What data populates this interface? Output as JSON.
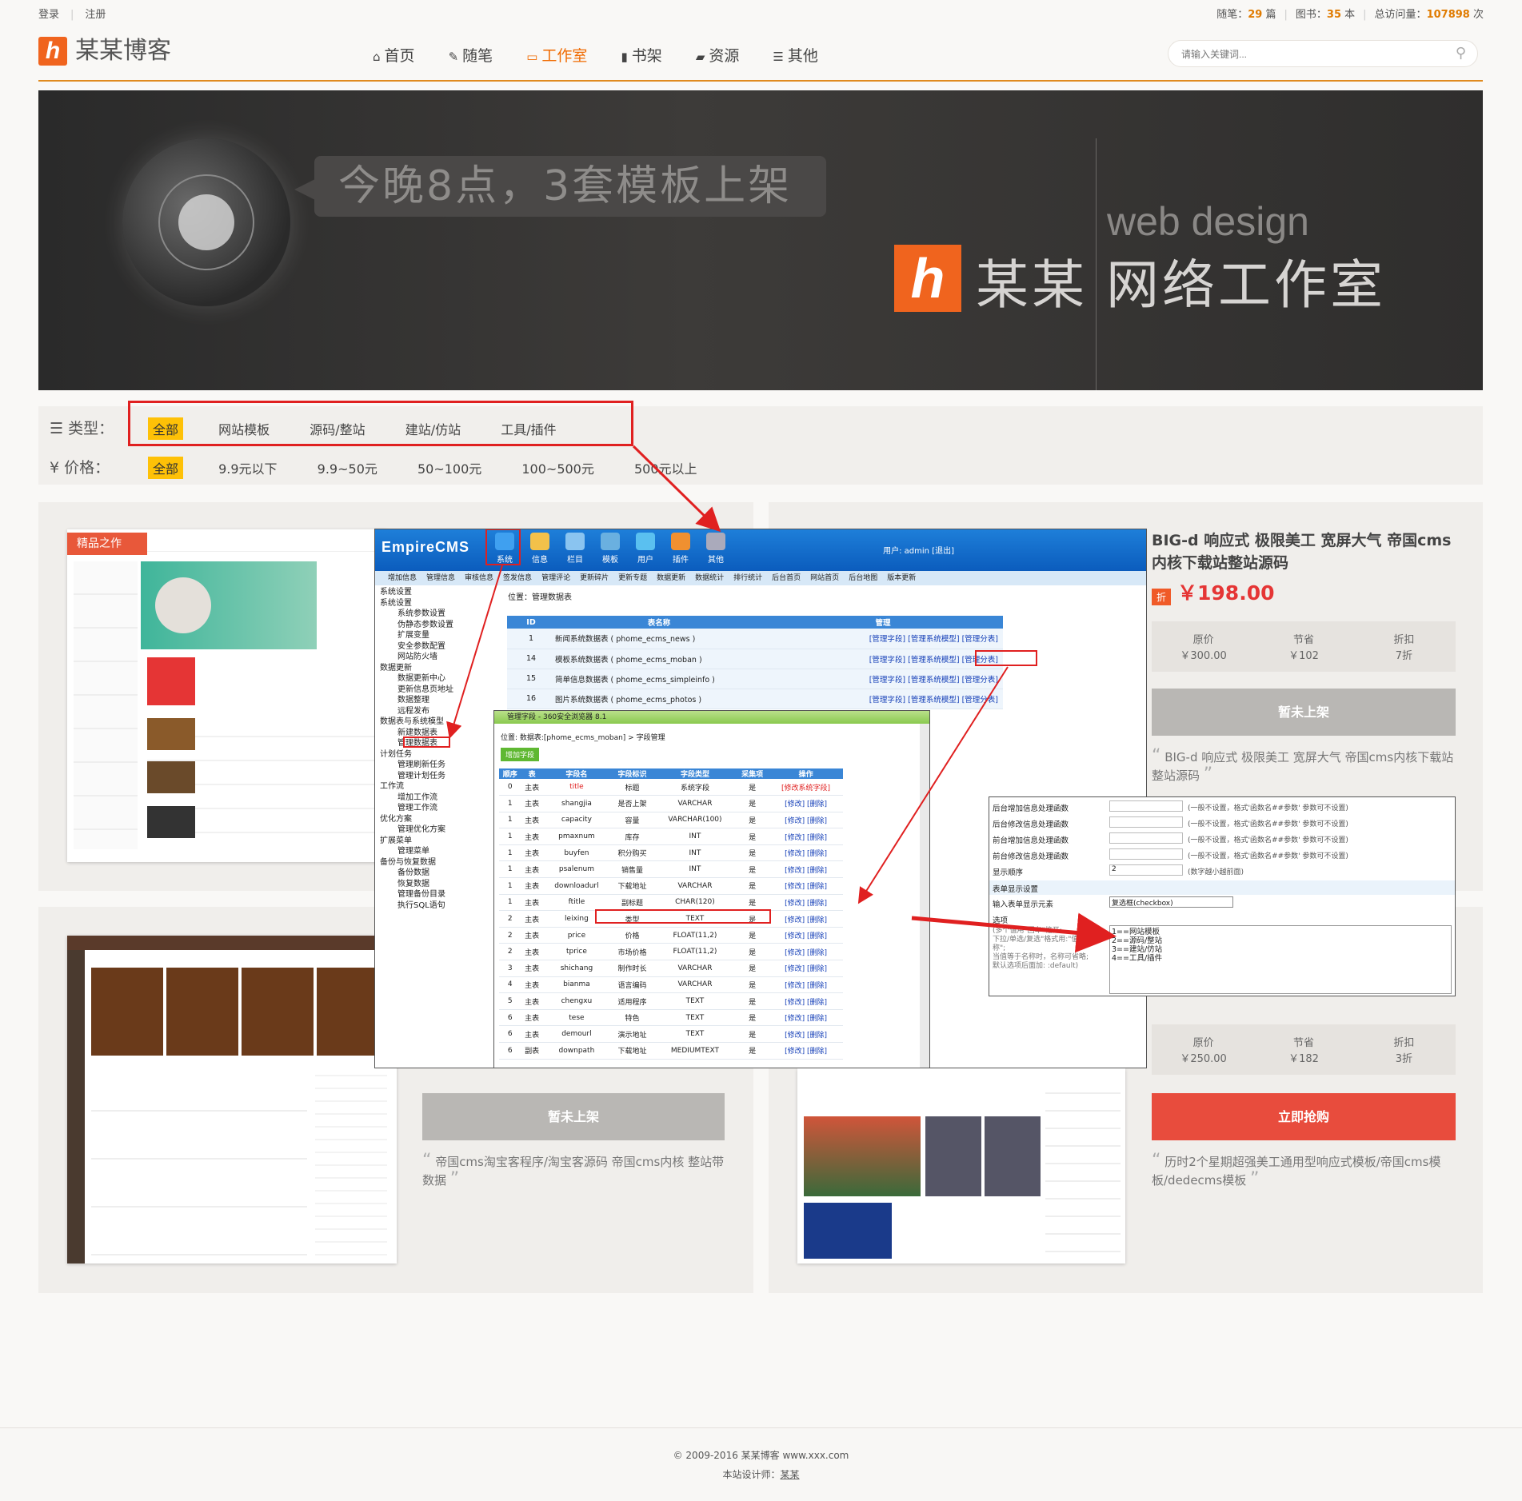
{
  "topbar": {
    "login": "登录",
    "register": "注册",
    "essay_label": "随笔：",
    "essay_count": "29",
    "essay_unit": "篇",
    "books_label": "图书：",
    "books_count": "35",
    "books_unit": "本",
    "visits_label": "总访问量：",
    "visits_count": "107898",
    "visits_unit": "次"
  },
  "header": {
    "logo_letter": "h",
    "site_name": "某某博客",
    "nav": [
      {
        "label": "首页",
        "icon": "home-icon",
        "glyph": "⌂"
      },
      {
        "label": "随笔",
        "icon": "edit-icon",
        "glyph": "✎"
      },
      {
        "label": "工作室",
        "icon": "laptop-icon",
        "glyph": "▭"
      },
      {
        "label": "书架",
        "icon": "book-icon",
        "glyph": "▮"
      },
      {
        "label": "资源",
        "icon": "folder-icon",
        "glyph": "▰"
      },
      {
        "label": "其他",
        "icon": "list-icon",
        "glyph": "☰"
      }
    ],
    "search_placeholder": "请输入关键词..."
  },
  "banner": {
    "headline": "今晚8点，3套模板上架",
    "web_design": "web design",
    "logo_letter": "h",
    "studio_name": "某某",
    "studio_title": "网络工作室"
  },
  "filters": {
    "type_label": "类型：",
    "type_options": [
      "全部",
      "网站模板",
      "源码/整站",
      "建站/仿站",
      "工具/插件"
    ],
    "price_label": "价格：",
    "price_options": [
      "全部",
      "9.9元以下",
      "9.9~50元",
      "50~100元",
      "100~500元",
      "500元以上"
    ]
  },
  "cards": [
    {
      "title": "BIG-d 响应式 极限美工 宽屏大气 帝国cms内核下载站整站源码",
      "discount_tag": "折",
      "price": "￥198.00",
      "stats": [
        {
          "label": "原价",
          "value": "￥300.00"
        },
        {
          "label": "节省",
          "value": "￥102"
        },
        {
          "label": "折扣",
          "value": "7折"
        }
      ],
      "button": "暂未上架",
      "desc": "BIG-d 响应式 极限美工 宽屏大气 帝国cms内核下载站整站源码",
      "thumb_badge": "精品之作"
    },
    {
      "button": "暂未上架",
      "desc": "帝国cms淘宝客程序/淘宝客源码 帝国cms内核 整站带数据"
    },
    {
      "stats": [
        {
          "label": "原价",
          "value": "￥250.00"
        },
        {
          "label": "节省",
          "value": "￥182"
        },
        {
          "label": "折扣",
          "value": "3折"
        }
      ],
      "button": "立即抢购",
      "desc": "历时2个星期超强美工通用型响应式模板/帝国cms模板/dedecms模板"
    }
  ],
  "cms": {
    "brand": "EmpireCMS",
    "icons": [
      "系统",
      "信息",
      "栏目",
      "模板",
      "用户",
      "插件",
      "其他"
    ],
    "user": "用户: admin [退出]",
    "menu": [
      "增加信息",
      "管理信息",
      "审核信息",
      "签发信息",
      "管理评论",
      "更新碎片",
      "更新专题",
      "数据更新",
      "数据统计",
      "排行统计",
      "后台首页",
      "网站首页",
      "后台地图",
      "版本更新"
    ],
    "location": "位置：管理数据表",
    "tree": [
      {
        "t": "系统设置",
        "lvl": 1
      },
      {
        "t": "系统设置",
        "lvl": 1
      },
      {
        "t": "系统参数设置",
        "lvl": 2
      },
      {
        "t": "伪静态参数设置",
        "lvl": 2
      },
      {
        "t": "扩展变量",
        "lvl": 2
      },
      {
        "t": "安全参数配置",
        "lvl": 2
      },
      {
        "t": "网站防火墙",
        "lvl": 2
      },
      {
        "t": "数据更新",
        "lvl": 1
      },
      {
        "t": "数据更新中心",
        "lvl": 2
      },
      {
        "t": "更新信息页地址",
        "lvl": 2
      },
      {
        "t": "数据整理",
        "lvl": 2
      },
      {
        "t": "远程发布",
        "lvl": 2
      },
      {
        "t": "数据表与系统模型",
        "lvl": 1
      },
      {
        "t": "新建数据表",
        "lvl": 2
      },
      {
        "t": "管理数据表",
        "lvl": 2
      },
      {
        "t": "计划任务",
        "lvl": 1
      },
      {
        "t": "管理刷新任务",
        "lvl": 2
      },
      {
        "t": "管理计划任务",
        "lvl": 2
      },
      {
        "t": "工作流",
        "lvl": 1
      },
      {
        "t": "增加工作流",
        "lvl": 2
      },
      {
        "t": "管理工作流",
        "lvl": 2
      },
      {
        "t": "优化方案",
        "lvl": 1
      },
      {
        "t": "管理优化方案",
        "lvl": 2
      },
      {
        "t": "扩展菜单",
        "lvl": 1
      },
      {
        "t": "管理菜单",
        "lvl": 2
      },
      {
        "t": "备份与恢复数据",
        "lvl": 1
      },
      {
        "t": "备份数据",
        "lvl": 2
      },
      {
        "t": "恢复数据",
        "lvl": 2
      },
      {
        "t": "管理备份目录",
        "lvl": 2
      },
      {
        "t": "执行SQL语句",
        "lvl": 2
      }
    ],
    "table_headers": [
      "ID",
      "表名称",
      "管理"
    ],
    "tables": [
      {
        "id": "1",
        "name": "新闻系统数据表 ( phome_ecms_news )"
      },
      {
        "id": "14",
        "name": "模板系统数据表 ( phome_ecms_moban )"
      },
      {
        "id": "15",
        "name": "简单信息数据表 ( phome_ecms_simpleinfo )"
      },
      {
        "id": "16",
        "name": "图片系统数据表 ( phome_ecms_photos )"
      }
    ],
    "table_action": "[管理字段] [管理系统模型] [管理分表]"
  },
  "fields_win": {
    "title": "管理字段 - 360安全浏览器 8.1",
    "location": "位置: 数据表:[phome_ecms_moban] > 字段管理",
    "add_button": "增加字段",
    "headers": [
      "顺序",
      "表",
      "字段名",
      "字段标识",
      "字段类型",
      "采集项",
      "操作"
    ],
    "rows": [
      [
        "0",
        "主表",
        "title",
        "标题",
        "系统字段",
        "是",
        "[修改系统字段]"
      ],
      [
        "1",
        "主表",
        "shangjia",
        "是否上架",
        "VARCHAR",
        "是",
        "[修改] [删除]"
      ],
      [
        "1",
        "主表",
        "capacity",
        "容量",
        "VARCHAR(100)",
        "是",
        "[修改] [删除]"
      ],
      [
        "1",
        "主表",
        "pmaxnum",
        "库存",
        "INT",
        "是",
        "[修改] [删除]"
      ],
      [
        "1",
        "主表",
        "buyfen",
        "积分购买",
        "INT",
        "是",
        "[修改] [删除]"
      ],
      [
        "1",
        "主表",
        "psalenum",
        "销售量",
        "INT",
        "是",
        "[修改] [删除]"
      ],
      [
        "1",
        "主表",
        "downloadurl",
        "下载地址",
        "VARCHAR",
        "是",
        "[修改] [删除]"
      ],
      [
        "1",
        "主表",
        "ftitle",
        "副标题",
        "CHAR(120)",
        "是",
        "[修改] [删除]"
      ],
      [
        "2",
        "主表",
        "leixing",
        "类型",
        "TEXT",
        "是",
        "[修改] [删除]"
      ],
      [
        "2",
        "主表",
        "price",
        "价格",
        "FLOAT(11,2)",
        "是",
        "[修改] [删除]"
      ],
      [
        "2",
        "主表",
        "tprice",
        "市场价格",
        "FLOAT(11,2)",
        "是",
        "[修改] [删除]"
      ],
      [
        "3",
        "主表",
        "shichang",
        "制作时长",
        "VARCHAR",
        "是",
        "[修改] [删除]"
      ],
      [
        "4",
        "主表",
        "bianma",
        "语言编码",
        "VARCHAR",
        "是",
        "[修改] [删除]"
      ],
      [
        "5",
        "主表",
        "chengxu",
        "适用程序",
        "TEXT",
        "是",
        "[修改] [删除]"
      ],
      [
        "6",
        "主表",
        "tese",
        "特色",
        "TEXT",
        "是",
        "[修改] [删除]"
      ],
      [
        "6",
        "主表",
        "demourl",
        "演示地址",
        "TEXT",
        "是",
        "[修改] [删除]"
      ],
      [
        "6",
        "副表",
        "downpath",
        "下载地址",
        "MEDIUMTEXT",
        "是",
        "[修改] [删除]"
      ]
    ]
  },
  "form_win": {
    "rows": [
      "后台增加信息处理函数",
      "后台修改信息处理函数",
      "前台增加信息处理函数",
      "前台修改信息处理函数",
      "显示顺序"
    ],
    "note": "(一般不设置，格式'函数名##参数' 参数可不设置)",
    "order_value": "2",
    "order_note": "(数字越小越前面)",
    "section": "表单显示设置",
    "element_label": "输入表单显示元素",
    "element_value": "复选框(checkbox)",
    "options_label": "选项",
    "options_text": "1==网站模板\n2==源码/整站\n3==建站/仿站\n4==工具/插件",
    "options_help": "(多个值用\"回车\"格开;\n下拉/单选/复选\"格式用:\"值==名称\";\n当值等于名称时，名称可省略;\n默认选项后面加: :default)"
  },
  "footer": {
    "copyright": "© 2009-2016 某某博客 www.xxx.com",
    "designer_label": "本站设计师：",
    "designer": "某某"
  },
  "colors": {
    "accent": "#f06a00",
    "brand_orange": "#f0641e",
    "highlight": "#fec107",
    "price_red": "#e53535",
    "buy_red": "#e84c3d",
    "annotation_red": "#e02020"
  }
}
